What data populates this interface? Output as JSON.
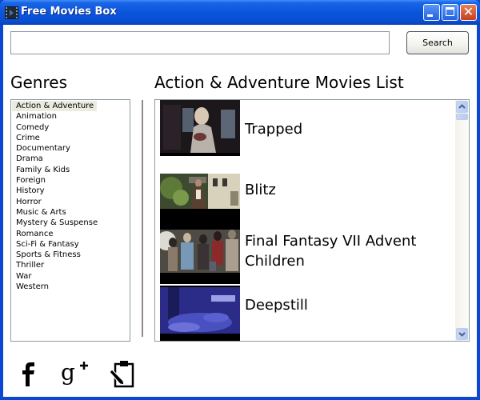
{
  "window": {
    "title": "Free Movies Box",
    "icon": "film-strip-icon",
    "controls": [
      "minimize",
      "maximize",
      "close"
    ],
    "close_glyph": "✕"
  },
  "search": {
    "value": "",
    "placeholder": "",
    "button_label": "Search"
  },
  "genres": {
    "title": "Genres",
    "selected": "Action & Adventure",
    "items": [
      "Action & Adventure",
      "Animation",
      "Comedy",
      "Crime",
      "Documentary",
      "Drama",
      "Family & Kids",
      "Foreign",
      "History",
      "Horror",
      "Music & Arts",
      "Mystery & Suspense",
      "Romance",
      "Sci-Fi & Fantasy",
      "Sports & Fitness",
      "Thriller",
      "War",
      "Western"
    ]
  },
  "movies": {
    "title": "Action & Adventure Movies List",
    "items": [
      {
        "title": "Trapped",
        "thumbnail": "dark-scene-woman-thumbnail",
        "colors": {
          "bg": "#1a1618",
          "accent": "#c7bdb0"
        }
      },
      {
        "title": "Blitz",
        "thumbnail": "street-scene-thumbnail",
        "colors": {
          "bg": "#3c4a2a",
          "accent": "#d8d2b8"
        }
      },
      {
        "title": "Final Fantasy VII Advent Children",
        "thumbnail": "group-characters-thumbnail",
        "colors": {
          "bg": "#5a5852",
          "accent": "#a8a49a"
        }
      },
      {
        "title": "Deepstill",
        "thumbnail": "blue-forest-thumbnail",
        "colors": {
          "bg": "#2a2f8a",
          "accent": "#8a90e6"
        }
      }
    ]
  },
  "social": {
    "items": [
      {
        "name": "facebook",
        "icon": "facebook-icon"
      },
      {
        "name": "google-plus",
        "icon": "google-plus-icon"
      },
      {
        "name": "feedback",
        "icon": "clipboard-edit-icon"
      }
    ]
  }
}
